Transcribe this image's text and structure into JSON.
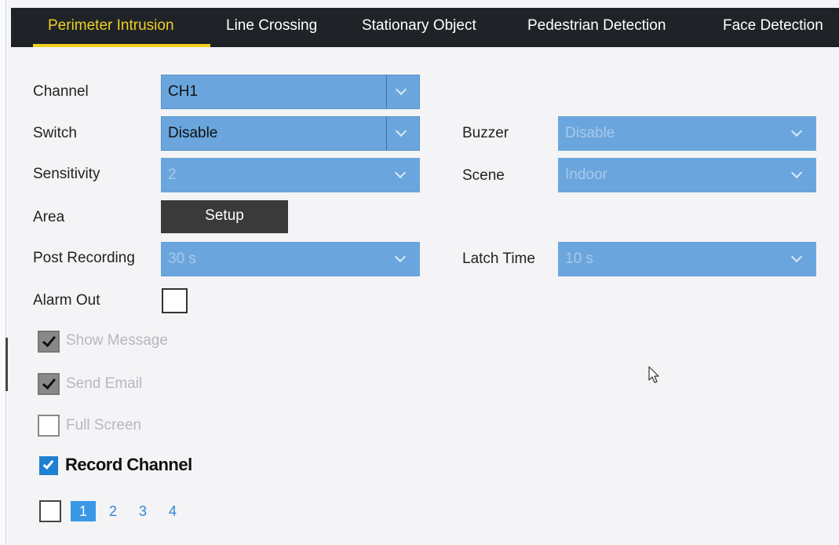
{
  "tabs": [
    {
      "label": "Perimeter Intrusion",
      "active": true
    },
    {
      "label": "Line Crossing",
      "active": false
    },
    {
      "label": "Stationary Object",
      "active": false
    },
    {
      "label": "Pedestrian Detection",
      "active": false
    },
    {
      "label": "Face Detection",
      "active": false
    }
  ],
  "form": {
    "channel": {
      "label": "Channel",
      "value": "CH1"
    },
    "switch": {
      "label": "Switch",
      "value": "Disable"
    },
    "sensitivity": {
      "label": "Sensitivity",
      "value": "2"
    },
    "area": {
      "label": "Area",
      "button": "Setup"
    },
    "post_recording": {
      "label": "Post Recording",
      "value": "30 s"
    },
    "alarm_out": {
      "label": "Alarm Out",
      "checked": false
    },
    "buzzer": {
      "label": "Buzzer",
      "value": "Disable"
    },
    "scene": {
      "label": "Scene",
      "value": "Indoor"
    },
    "latch_time": {
      "label": "Latch Time",
      "value": "10 s"
    }
  },
  "options": {
    "show_message": {
      "label": "Show Message",
      "checked": true
    },
    "send_email": {
      "label": "Send Email",
      "checked": true
    },
    "full_screen": {
      "label": "Full Screen",
      "checked": false
    },
    "record_channel": {
      "label": "Record Channel",
      "checked": true
    }
  },
  "record_channels": {
    "all_checked": false,
    "channels": [
      "1",
      "2",
      "3",
      "4"
    ],
    "selected": "1"
  },
  "colors": {
    "tab_active": "#f0d020",
    "tab_bar": "#1f2328",
    "select_fill": "#6aa6dd",
    "setup_button": "#3a3a3a",
    "checkbox_blue": "#1f7fd1"
  },
  "icons": [
    "chevron-down-icon",
    "checkmark-icon",
    "mouse-cursor-icon"
  ]
}
